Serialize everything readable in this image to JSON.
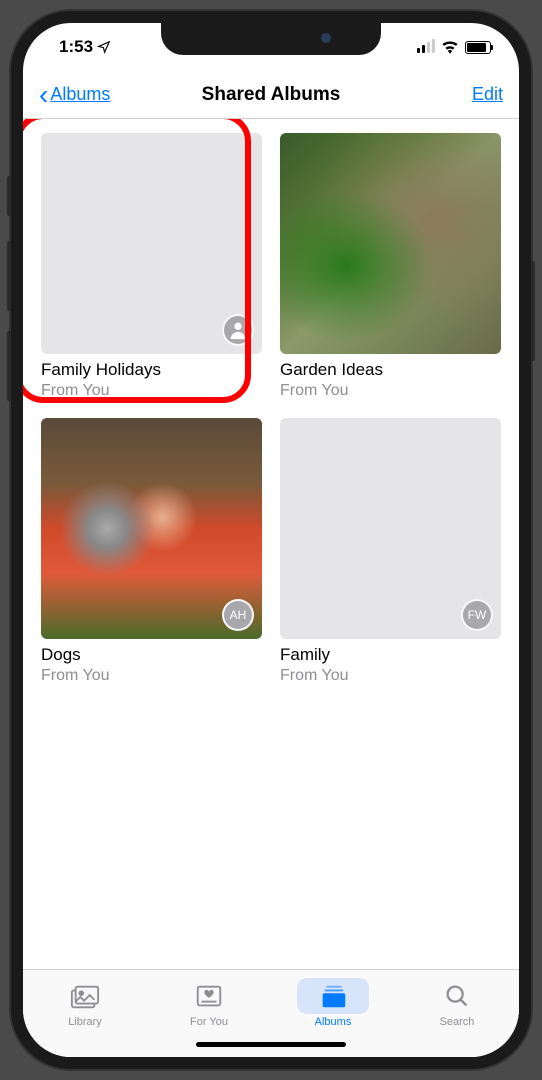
{
  "status": {
    "time": "1:53",
    "location_icon": "location-arrow"
  },
  "nav": {
    "back_label": "Albums",
    "title": "Shared Albums",
    "edit_label": "Edit"
  },
  "albums": [
    {
      "title": "Family Holidays",
      "subtitle": "From You",
      "badge_type": "person",
      "badge_text": "",
      "thumb": "blank",
      "highlighted": true
    },
    {
      "title": "Garden Ideas",
      "subtitle": "From You",
      "badge_type": "none",
      "badge_text": "",
      "thumb": "garden",
      "highlighted": false
    },
    {
      "title": "Dogs",
      "subtitle": "From You",
      "badge_type": "initials",
      "badge_text": "AH",
      "thumb": "dogs",
      "highlighted": false
    },
    {
      "title": "Family",
      "subtitle": "From You",
      "badge_type": "initials",
      "badge_text": "FW",
      "thumb": "blank",
      "highlighted": false
    }
  ],
  "tabs": [
    {
      "label": "Library",
      "icon": "library",
      "active": false
    },
    {
      "label": "For You",
      "icon": "foryou",
      "active": false
    },
    {
      "label": "Albums",
      "icon": "albums",
      "active": true
    },
    {
      "label": "Search",
      "icon": "search",
      "active": false
    }
  ]
}
